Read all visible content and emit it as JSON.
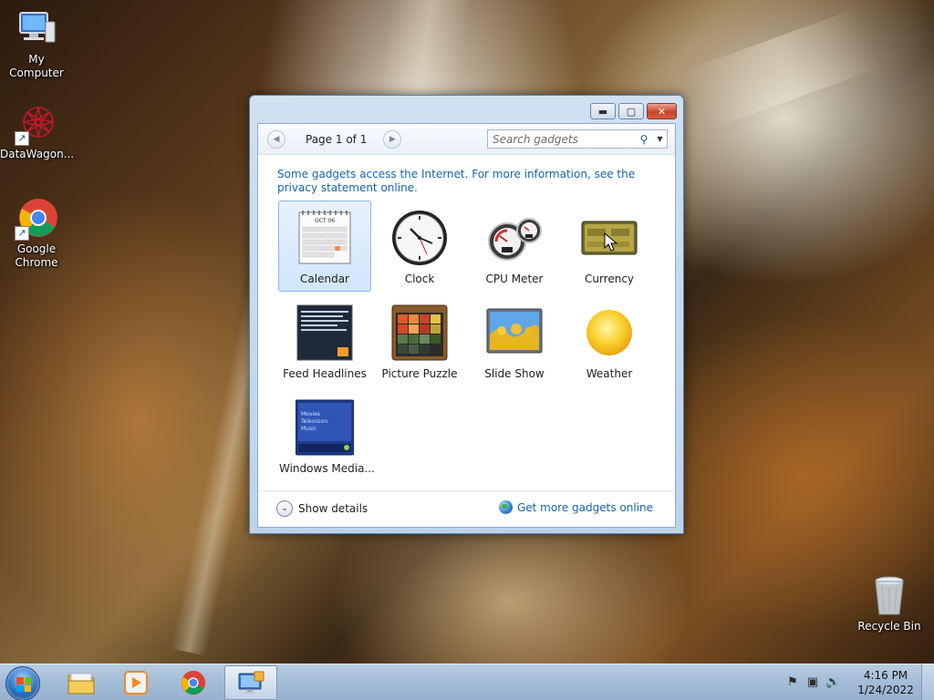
{
  "desktop": {
    "icons": [
      {
        "label": "My Computer",
        "icon": "computer-icon",
        "shortcut": false
      },
      {
        "label": "DataWagon...",
        "icon": "datawagon-icon",
        "shortcut": true
      },
      {
        "label": "Google Chrome",
        "icon": "chrome-icon",
        "shortcut": true
      },
      {
        "label": "Recycle Bin",
        "icon": "recycle-bin-icon",
        "shortcut": false
      }
    ]
  },
  "window": {
    "controls": {
      "minimize": "minimize",
      "restore": "restore",
      "close": "close"
    },
    "pager": {
      "label": "Page 1 of 1"
    },
    "search": {
      "placeholder": "Search gadgets"
    },
    "info_text": "Some gadgets access the Internet.  For more information, see the privacy statement online.",
    "gadgets": [
      {
        "name": "Calendar",
        "icon": "calendar-icon",
        "selected": true,
        "month": "OCT 06"
      },
      {
        "name": "Clock",
        "icon": "clock-icon",
        "selected": false
      },
      {
        "name": "CPU Meter",
        "icon": "cpu-meter-icon",
        "selected": false
      },
      {
        "name": "Currency",
        "icon": "currency-icon",
        "selected": false
      },
      {
        "name": "Feed Headlines",
        "icon": "feed-headlines-icon",
        "selected": false
      },
      {
        "name": "Picture Puzzle",
        "icon": "picture-puzzle-icon",
        "selected": false
      },
      {
        "name": "Slide Show",
        "icon": "slide-show-icon",
        "selected": false
      },
      {
        "name": "Weather",
        "icon": "weather-icon",
        "selected": false
      },
      {
        "name": "Windows Media...",
        "icon": "windows-media-icon",
        "selected": false,
        "menu": [
          "Movies",
          "Television",
          "Music"
        ]
      }
    ],
    "show_details": "Show details",
    "get_more": "Get more gadgets online"
  },
  "taskbar": {
    "pinned": [
      "explorer-icon",
      "media-player-icon",
      "chrome-icon",
      "gadgets-icon"
    ],
    "clock": {
      "time": "4:16 PM",
      "date": "1/24/2022"
    }
  },
  "colors": {
    "link": "#1764ad",
    "selection": "#d1e5fb",
    "close_button": "#c8452d"
  }
}
